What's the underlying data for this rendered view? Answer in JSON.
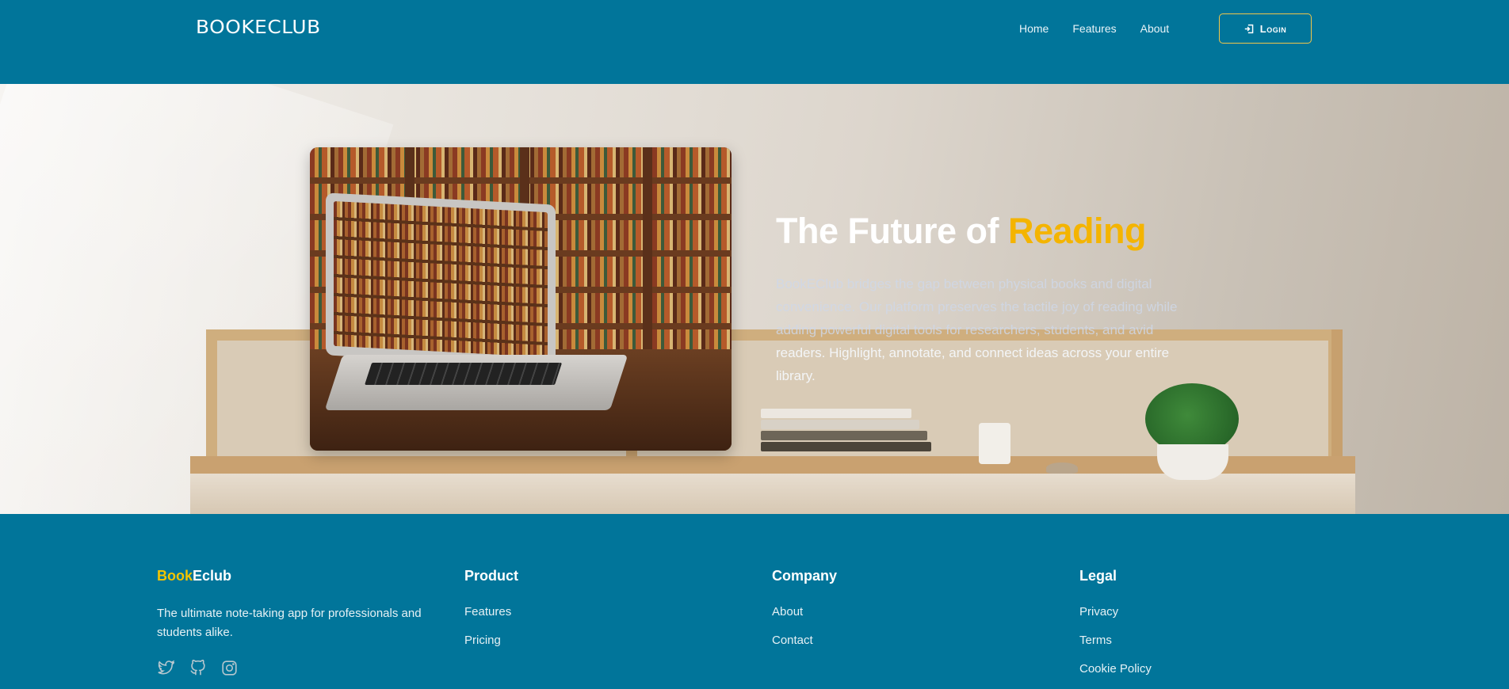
{
  "header": {
    "logo": "BOOKECLUB",
    "nav": [
      "Home",
      "Features",
      "About"
    ],
    "login_label": "Login"
  },
  "hero": {
    "title_part1": "The Future of ",
    "title_accent": "Reading",
    "description_faded": "BookEClub bridges the gap between physical books and digital convenience. Our platform preserves the tactile joy of reading while adding powerful digital tools for researchers, students, and avid",
    "description_clear": " readers. Highlight, annotate, and connect ideas across your entire library."
  },
  "footer": {
    "brand_part1": "Book",
    "brand_part2": "Eclub",
    "tagline": "The ultimate note-taking app for professionals and students alike.",
    "columns": [
      {
        "heading": "Product",
        "links": [
          "Features",
          "Pricing"
        ]
      },
      {
        "heading": "Company",
        "links": [
          "About",
          "Contact"
        ]
      },
      {
        "heading": "Legal",
        "links": [
          "Privacy",
          "Terms",
          "Cookie Policy"
        ]
      }
    ],
    "socials": [
      "twitter-icon",
      "github-icon",
      "instagram-icon"
    ]
  },
  "colors": {
    "primary": "#01759a",
    "accent": "#f4b400",
    "brand_yellow": "#f4c400",
    "login_border": "#f0c64a"
  }
}
